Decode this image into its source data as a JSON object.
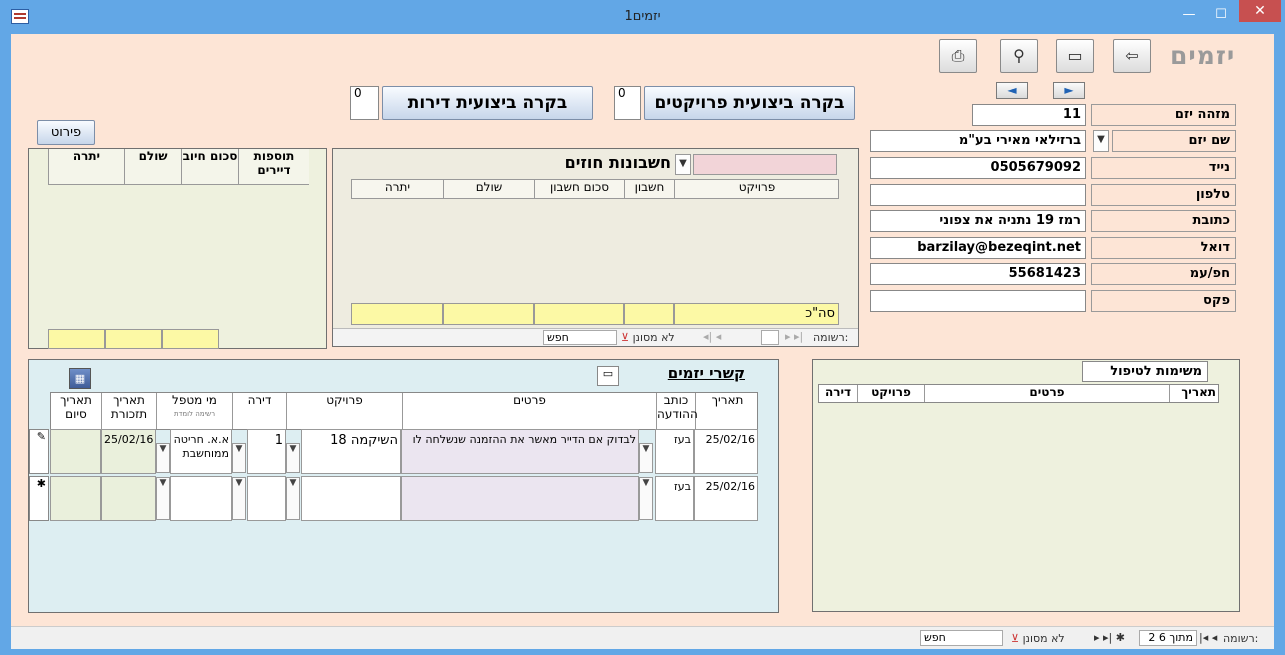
{
  "window": {
    "title": "יזמים1",
    "minimize": "—",
    "maximize": "☐",
    "close": "✕"
  },
  "header": {
    "heading": "יזמים"
  },
  "toolbar": {
    "exit_icon": "exit-icon",
    "new_icon": "new-record-icon",
    "find_icon": "binoculars-icon",
    "report_icon": "report-icon"
  },
  "nav": {
    "prev": "◄",
    "next": "►"
  },
  "checks": {
    "projects_btn": "בקרה ביצועית פרויקטים",
    "projects_count": "0",
    "apartments_btn": "בקרה ביצועית דירות",
    "apartments_count": "0"
  },
  "details_btn": "פירוט",
  "fields": [
    {
      "label": "מזהה יזם",
      "value": "11"
    },
    {
      "label": "שם יזם",
      "value": "ברזילאי מאירי בע\"מ"
    },
    {
      "label": "נייד",
      "value": "0505679092"
    },
    {
      "label": "טלפון",
      "value": ""
    },
    {
      "label": "כתובת",
      "value": "רמז 19 נתניה את צפוני"
    },
    {
      "label": "דואל",
      "value": "barzilay@bezeqint.net"
    },
    {
      "label": "חפ/עמ",
      "value": "55681423"
    },
    {
      "label": "פקס",
      "value": ""
    }
  ],
  "left_panel": {
    "columns": [
      "תוספות דיירים",
      "סכום חיוב",
      "שולם",
      "יתרה"
    ]
  },
  "accounts": {
    "title": "חשבונות חוזים",
    "columns": [
      "פרויקט",
      "חשבון",
      "סכום חשבון",
      "שולם",
      "יתרה"
    ],
    "total_label": "סה\"כ",
    "nav_label": "רשומה:",
    "filter": "לא מסונן",
    "search": "חפש"
  },
  "tasks": {
    "title": "משימות לטיפול",
    "columns": [
      "תאריך",
      "פרטים",
      "פרויקט",
      "דירה"
    ]
  },
  "contacts": {
    "title": "קשרי יזמים",
    "columns": [
      "תאריך",
      "כותב ההודעה",
      "פרטים",
      "פרויקט",
      "דירה",
      "מי מטפל",
      "תאריך תזכורת",
      "תאריך סיום"
    ],
    "handler_sub": "רשימה לומדת",
    "rows": [
      {
        "date": "25/02/16",
        "writer": "בעז",
        "details": "לבדוק אם הדייר מאשר את ההזמנה שנשלחה לו",
        "project": "השיקמה 18",
        "apt": "1",
        "handler": "א.א. חריטה ממוחשבת",
        "reminder": "25/02/16",
        "end": "",
        "marker": "✎"
      },
      {
        "date": "25/02/16",
        "writer": "בעז",
        "details": "",
        "project": "",
        "apt": "",
        "handler": "",
        "reminder": "",
        "end": "",
        "marker": "✱"
      }
    ]
  },
  "status": {
    "nav_label": "רשומה:",
    "position": "2 מתוך 6",
    "filter": "לא מסונן",
    "search": "חפש"
  }
}
